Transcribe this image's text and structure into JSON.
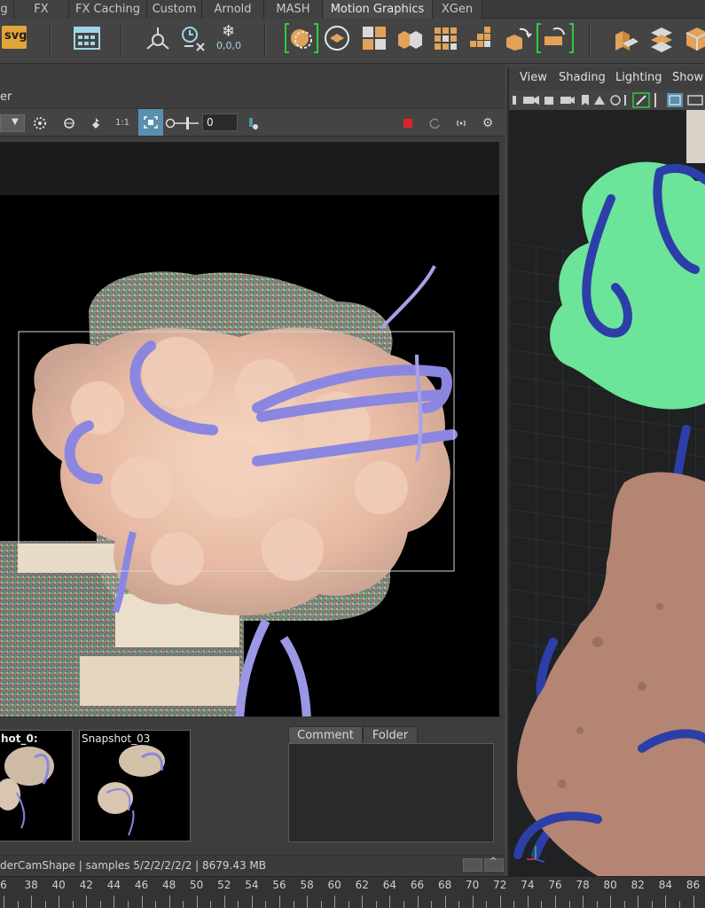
{
  "shelf_tabs": [
    {
      "label": "g"
    },
    {
      "label": "FX"
    },
    {
      "label": "FX Caching"
    },
    {
      "label": "Custom"
    },
    {
      "label": "Arnold"
    },
    {
      "label": "MASH"
    },
    {
      "label": "Motion Graphics",
      "active": true
    },
    {
      "label": "XGen"
    }
  ],
  "shelf": {
    "svg_label": "svg",
    "snap_label": "0,0,0",
    "icons": [
      "svg-tool-icon",
      "grid-layout-icon",
      "camera-rig-icon",
      "clock-time-icon",
      "snowflake-freeze-icon",
      "select-lasso-icon",
      "layer-disc-icon",
      "tile-split-icon",
      "cube-pair-icon",
      "grid-cubes-icon",
      "grid-stack-icon",
      "transform-cycle-icon",
      "transform-bracket-icon",
      "stack-blocks-icon",
      "diamond-stack-icon",
      "box-open-icon"
    ]
  },
  "render_view": {
    "title": "er",
    "exposure_value": "0",
    "ratio_label": "1:1",
    "colors": {
      "record": "#d9262c",
      "highlight": "#5a8fb0"
    }
  },
  "snapshots": [
    {
      "label": "hot_0:"
    },
    {
      "label": "Snapshot_03"
    }
  ],
  "snapshot_tabs": [
    "Comment",
    "Folder"
  ],
  "status": {
    "text": "derCamShape  | samples 5/2/2/2/2/2 | 8679.43 MB"
  },
  "viewport": {
    "menu": [
      "View",
      "Shading",
      "Lighting",
      "Show"
    ],
    "accent_color": "#6ce49a"
  },
  "time_slider": {
    "labels": [
      "6",
      "38",
      "40",
      "42",
      "44",
      "46",
      "48",
      "50",
      "52",
      "54",
      "56",
      "58",
      "60",
      "62",
      "64",
      "66",
      "68",
      "70",
      "72",
      "74",
      "76",
      "78",
      "80",
      "82",
      "84",
      "86"
    ]
  }
}
